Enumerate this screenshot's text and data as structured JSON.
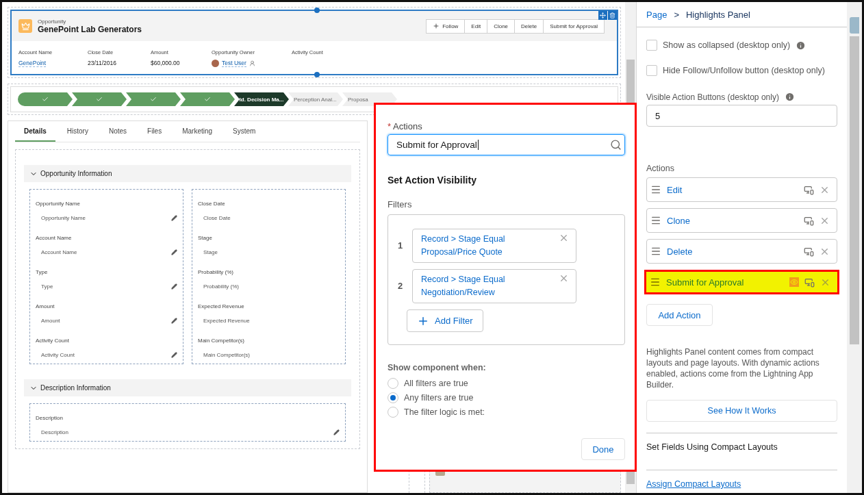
{
  "record": {
    "object_label": "Opportunity",
    "title": "GenePoint Lab Generators",
    "buttons": [
      {
        "label": "Follow",
        "kind": "follow"
      },
      {
        "label": "Edit",
        "kind": "plain"
      },
      {
        "label": "Clone",
        "kind": "plain"
      },
      {
        "label": "Delete",
        "kind": "plain"
      },
      {
        "label": "Submit for Approval",
        "kind": "plain"
      }
    ],
    "fields": [
      {
        "label": "Account Name",
        "value": "GenePoint",
        "kind": "link"
      },
      {
        "label": "Close Date",
        "value": "23/11/2016",
        "kind": "text"
      },
      {
        "label": "Amount",
        "value": "$60,000.00",
        "kind": "text"
      },
      {
        "label": "Opportunity Owner",
        "value": "Test User",
        "kind": "user"
      },
      {
        "label": "Activity Count",
        "kind": "text"
      }
    ]
  },
  "path": [
    {
      "complete": true,
      "current": false
    },
    {
      "complete": true,
      "current": false
    },
    {
      "complete": true,
      "current": false
    },
    {
      "complete": true,
      "current": false
    },
    {
      "label": "Id. Decision Ma...",
      "complete": false,
      "current": true
    },
    {
      "label": "Perception Anal...",
      "complete": false,
      "current": false
    },
    {
      "label": "Proposa",
      "complete": false,
      "current": false
    }
  ],
  "tabs": [
    {
      "label": "Details",
      "selected": true
    },
    {
      "label": "History",
      "selected": false
    },
    {
      "label": "Notes",
      "selected": false
    },
    {
      "label": "Files",
      "selected": false
    },
    {
      "label": "Marketing",
      "selected": false
    },
    {
      "label": "System",
      "selected": false
    }
  ],
  "sections": [
    {
      "title": "Opportunity Information",
      "expanded": true,
      "columns": [
        [
          {
            "label": "Opportunity Name",
            "value": "Opportunity Name",
            "editable": true
          },
          {
            "label": "Account Name",
            "value": "Account Name",
            "editable": true
          },
          {
            "label": "Type",
            "value": "Type",
            "editable": true
          },
          {
            "label": "Amount",
            "value": "Amount",
            "editable": true
          },
          {
            "label": "Activity Count",
            "value": "Activity Count",
            "editable": true
          }
        ],
        [
          {
            "label": "Close Date",
            "value": "Close Date",
            "editable": false
          },
          {
            "label": "Stage",
            "value": "Stage",
            "editable": false
          },
          {
            "label": "Probability (%)",
            "value": "Probability (%)",
            "editable": false
          },
          {
            "label": "Expected Revenue",
            "value": "Expected Revenue",
            "editable": false
          },
          {
            "label": "Main Competitor(s)",
            "value": "Main Competitor(s)",
            "editable": false
          }
        ]
      ]
    },
    {
      "title": "Description Information",
      "expanded": true,
      "columns": [
        [
          {
            "label": "Description",
            "value": "Description",
            "editable": true
          }
        ]
      ]
    }
  ],
  "popover": {
    "actions_label": "Actions",
    "required_mark": "*",
    "actions_value": "Submit for Approval",
    "visibility_title": "Set Action Visibility",
    "filters_label": "Filters",
    "filters": [
      {
        "number": "1",
        "text": "Record > Stage Equal Proposal/Price Quote"
      },
      {
        "number": "2",
        "text": "Record > Stage Equal Negotiation/Review"
      }
    ],
    "add_filter": "Add Filter",
    "show_when": "Show component when:",
    "options": [
      {
        "label": "All filters are true",
        "selected": false
      },
      {
        "label": "Any filters are true",
        "selected": true
      },
      {
        "label": "The filter logic is met:",
        "selected": false
      }
    ],
    "done": "Done"
  },
  "panel": {
    "breadcrumb": [
      {
        "label": "Page",
        "kind": "link"
      },
      {
        "label": ">",
        "kind": "separator"
      },
      {
        "label": "Highlights Panel",
        "kind": "current"
      }
    ],
    "checkboxes": [
      {
        "label": "Show as collapsed (desktop only)",
        "checked": false,
        "info": true
      },
      {
        "label": "Hide Follow/Unfollow button (desktop only)",
        "checked": false,
        "info": false
      }
    ],
    "visible_buttons": {
      "label": "Visible Action Buttons (desktop only)",
      "value": "5"
    },
    "actions_label": "Actions",
    "actions": [
      {
        "label": "Edit",
        "highlighted": false,
        "has_visibility": false
      },
      {
        "label": "Clone",
        "highlighted": false,
        "has_visibility": false
      },
      {
        "label": "Delete",
        "highlighted": false,
        "has_visibility": false
      },
      {
        "label": "Submit for Approval",
        "highlighted": true,
        "has_visibility": true
      }
    ],
    "add_action": "Add Action",
    "help": "Highlights Panel content comes from compact layouts and page layouts. With dynamic actions enabled, actions come from the Lightning App Builder.",
    "see_how": "See How It Works",
    "links": [
      {
        "label": "Set Fields Using Compact Layouts",
        "kind": "plain"
      },
      {
        "label": "Assign Compact Layouts",
        "kind": "link"
      }
    ]
  }
}
